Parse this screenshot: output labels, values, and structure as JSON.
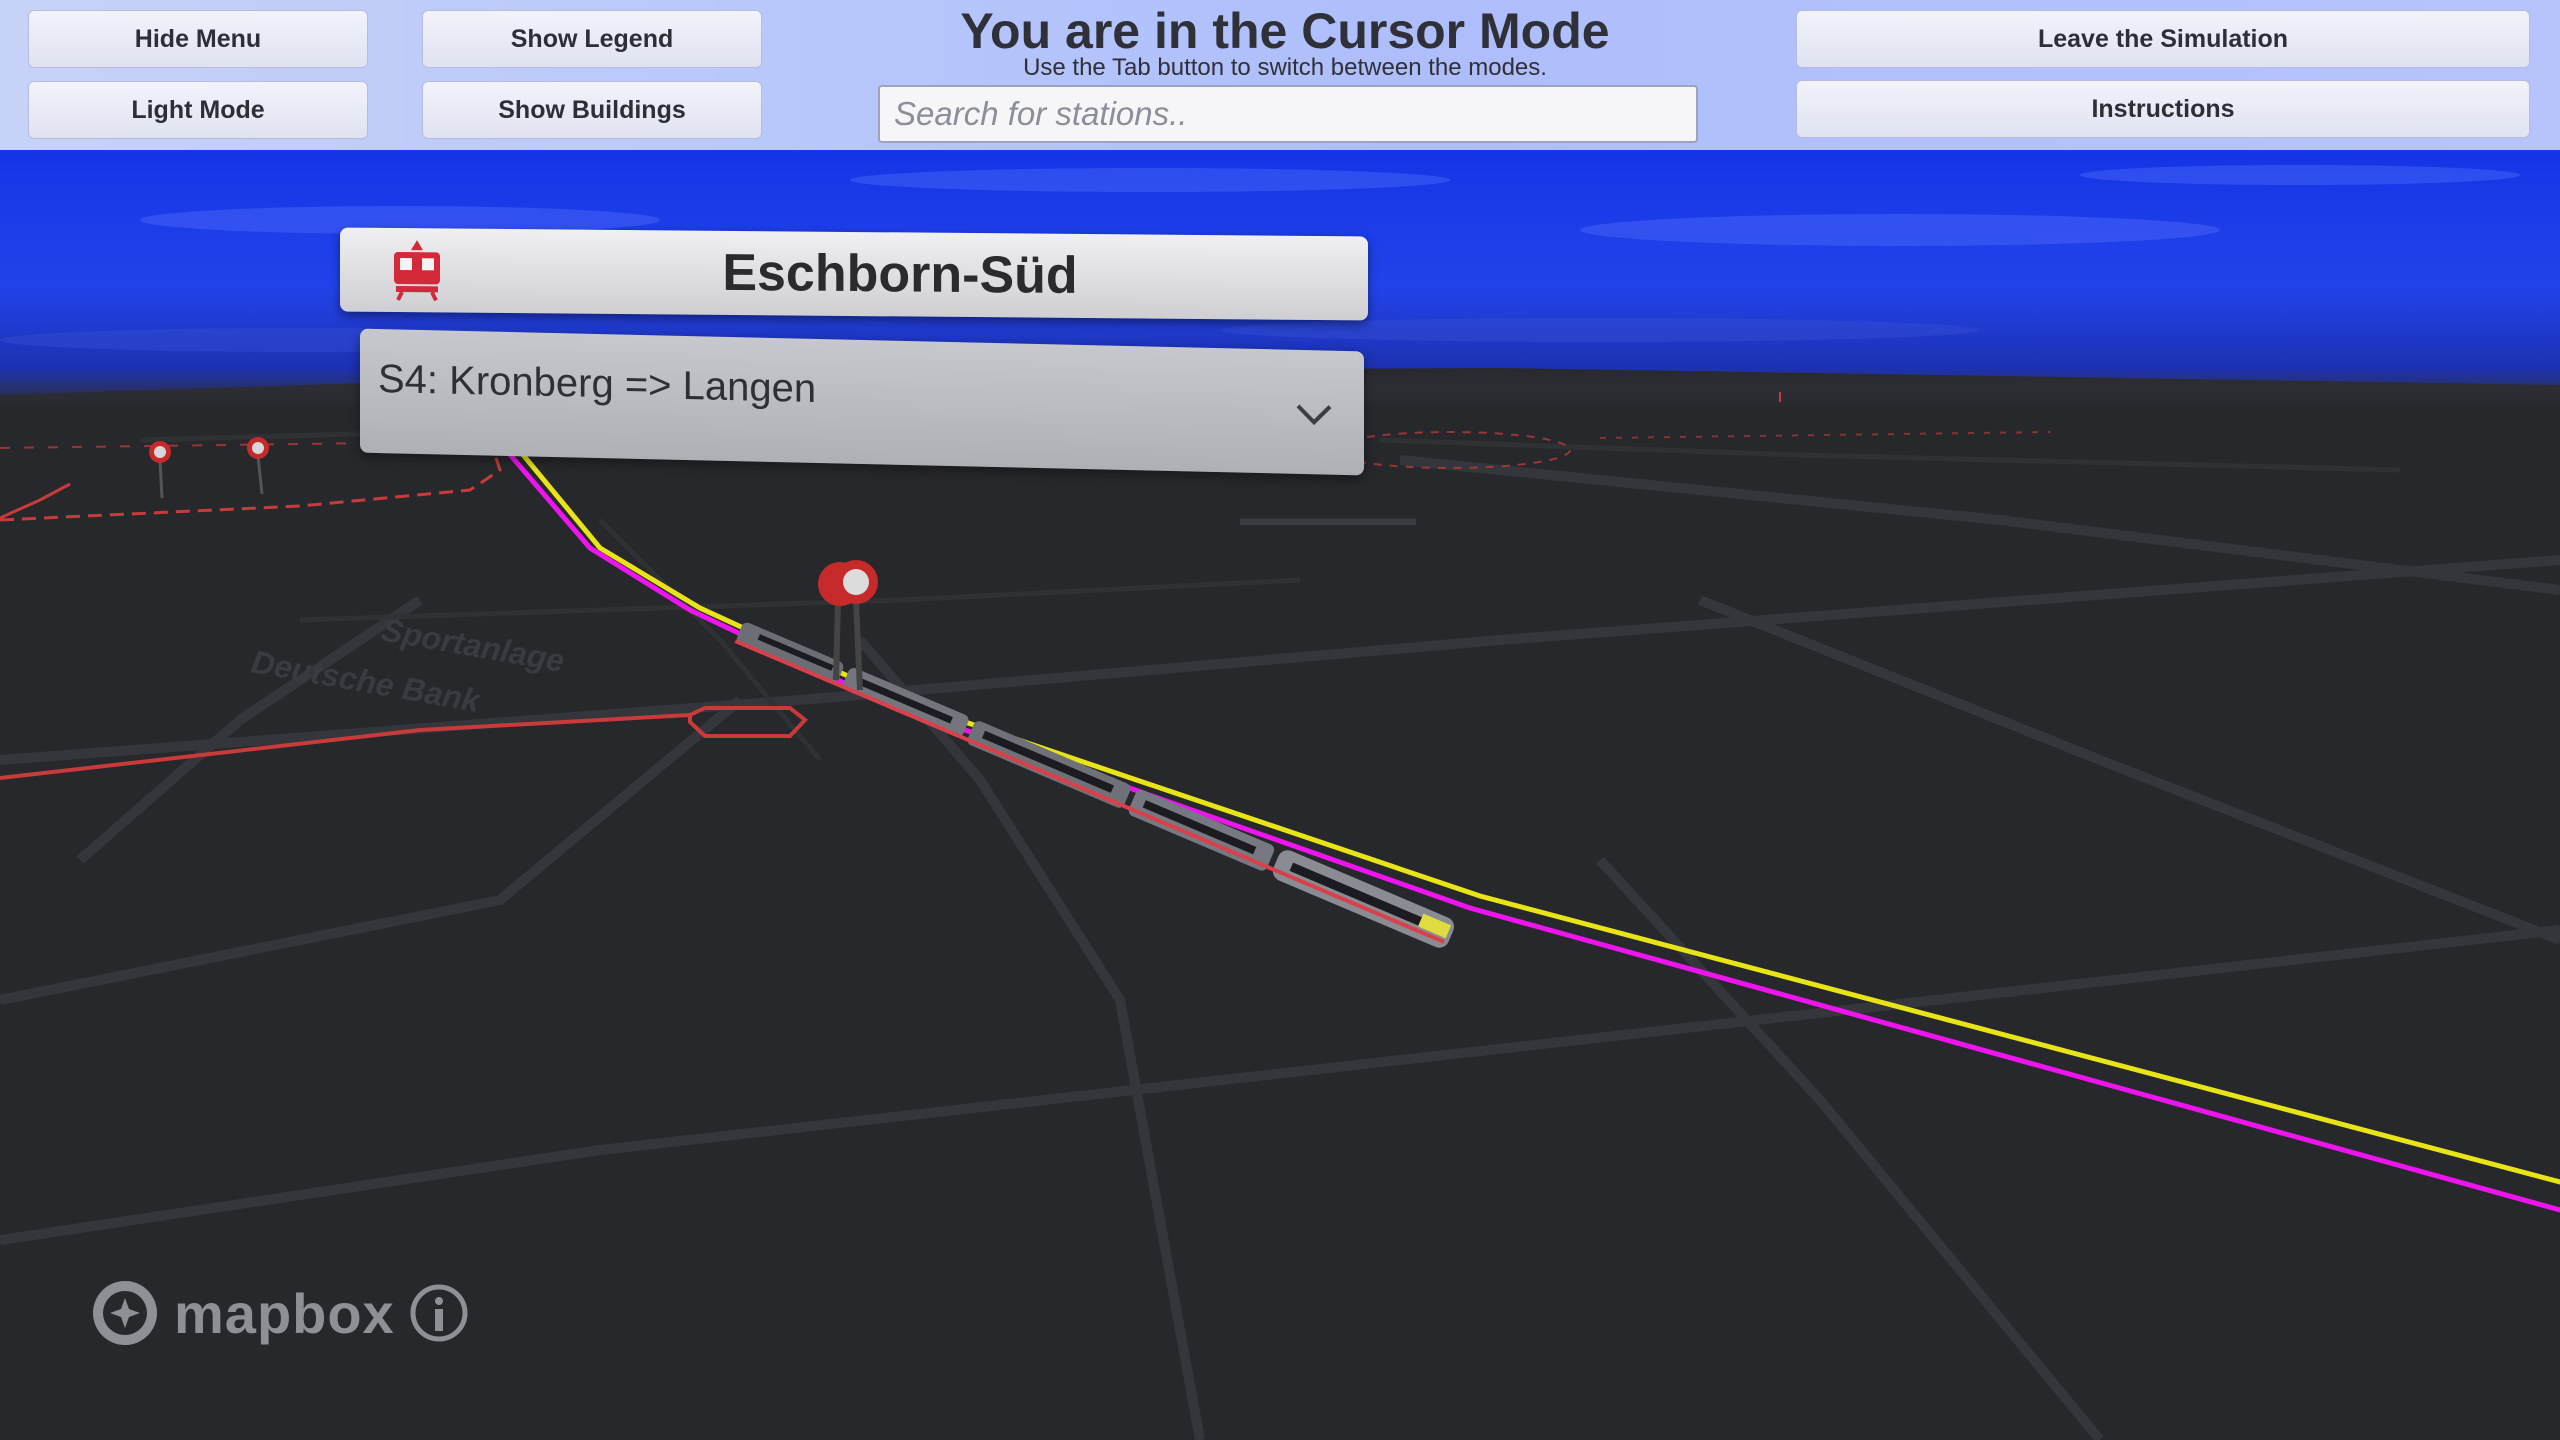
{
  "menu": {
    "hide_menu": "Hide Menu",
    "light_mode": "Light Mode",
    "show_legend": "Show Legend",
    "show_buildings": "Show Buildings",
    "leave_simulation": "Leave the Simulation",
    "instructions": "Instructions"
  },
  "mode": {
    "title": "You are in the Cursor Mode",
    "subtitle": "Use the Tab button to switch between the modes."
  },
  "search": {
    "placeholder": "Search for stations.."
  },
  "station_panel": {
    "name": "Eschborn-Süd",
    "icon": "train-icon"
  },
  "line_dropdown": {
    "selected": "S4: Kronberg => Langen",
    "icon": "chevron-down-icon"
  },
  "map": {
    "area_label": "Sportanlage Deutsche Bank",
    "attribution": "mapbox",
    "info_icon": "info-icon",
    "logo_icon": "mapbox-logo-icon"
  },
  "colors": {
    "sky": "#1637e8",
    "ground": "#27282c",
    "route_yellow": "#e8e417",
    "route_magenta": "#ee14ee",
    "road_red": "#c93a3a"
  }
}
